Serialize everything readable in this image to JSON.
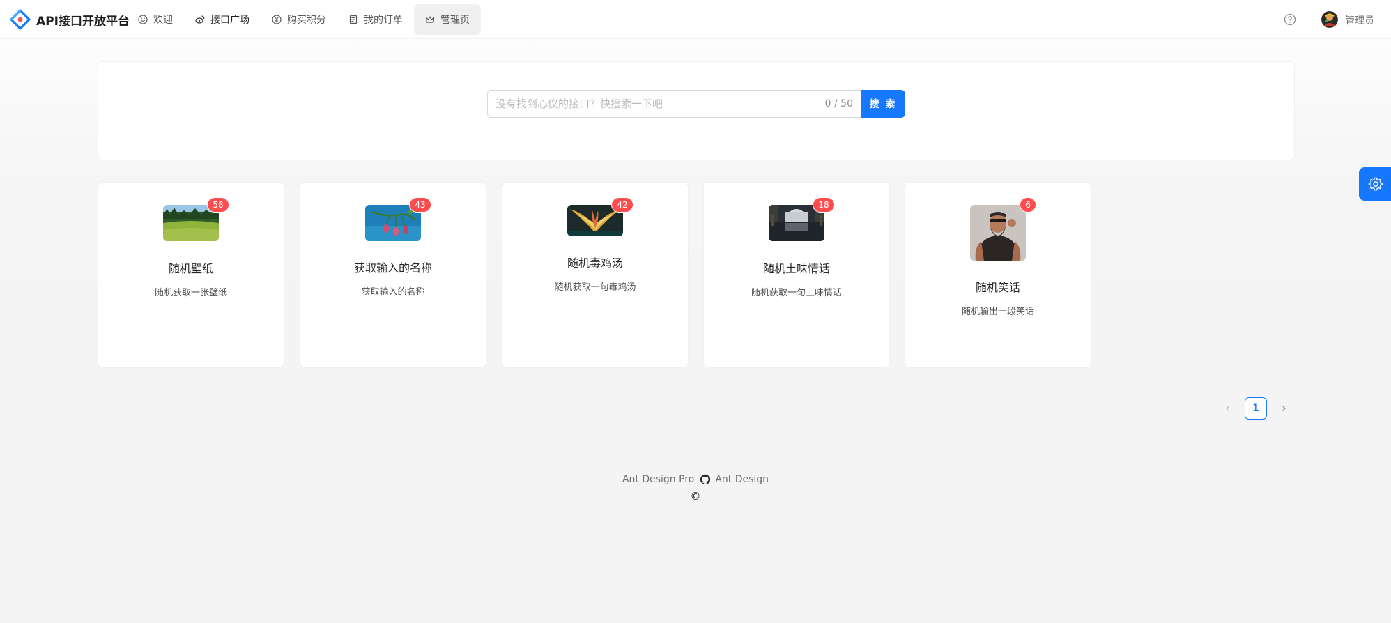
{
  "header": {
    "app_title": "API接口开放平台",
    "nav": [
      {
        "label": "欢迎",
        "icon": "smile-icon"
      },
      {
        "label": "接口广场",
        "icon": "weibo-icon"
      },
      {
        "label": "购买积分",
        "icon": "yen-circle-icon"
      },
      {
        "label": "我的订单",
        "icon": "order-icon"
      },
      {
        "label": "管理页",
        "icon": "crown-icon"
      }
    ],
    "active_nav": "管理页",
    "user_name": "管理员"
  },
  "search": {
    "placeholder": "没有找到心仪的接口？快搜索一下吧",
    "value": "",
    "counter": "0 / 50",
    "button_label": "搜 索"
  },
  "cards": [
    {
      "name": "随机壁纸",
      "description": "随机获取一张壁纸",
      "count": "58",
      "thumbnail": "green-meadow"
    },
    {
      "name": "获取输入的名称",
      "description": "获取输入的名称",
      "count": "43",
      "thumbnail": "flowers-blue-sky"
    },
    {
      "name": "随机毒鸡汤",
      "description": "随机获取一句毒鸡汤",
      "count": "42",
      "thumbnail": "golden-wings-art"
    },
    {
      "name": "随机土味情话",
      "description": "随机获取一句土味情话",
      "count": "18",
      "thumbnail": "palace-reflection"
    },
    {
      "name": "随机笑话",
      "description": "随机输出一段笑话",
      "count": "6",
      "thumbnail": "bearded-man"
    }
  ],
  "pagination": {
    "current": "1"
  },
  "footer": {
    "links": [
      "Ant Design Pro",
      "Ant Design"
    ],
    "copyright": "©"
  },
  "colors": {
    "primary": "#1677ff",
    "badge": "#ff4d4f"
  }
}
